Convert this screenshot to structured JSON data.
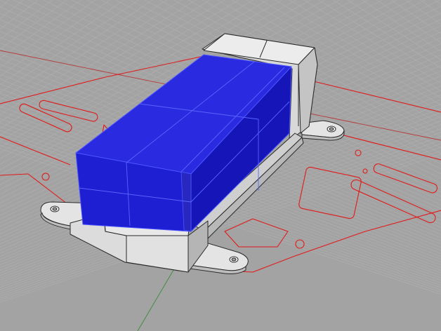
{
  "viewport": {
    "label": "",
    "projection": "perspective",
    "display_mode": "shaded",
    "grid": true
  },
  "colors": {
    "background": "#a3a3a3",
    "grid_line": "#b0b0b0",
    "grid_axis_x": "#b53a3a",
    "grid_axis_y": "#3a8a3a",
    "curve_outline": "#e01a1a",
    "battery_fill": "#1d1dcc",
    "battery_edge": "#5a64ff",
    "holder_face": "#e6e6e6",
    "holder_edge": "#2a2a2a"
  },
  "scene": {
    "objects": [
      {
        "name": "frame-plate-outline",
        "type": "curve"
      },
      {
        "name": "battery-holder",
        "type": "polysurface"
      },
      {
        "name": "battery-pack",
        "type": "polysurface",
        "selected": true
      },
      {
        "name": "mount-tab-left",
        "type": "polysurface"
      },
      {
        "name": "mount-tab-right",
        "type": "polysurface"
      },
      {
        "name": "mount-tab-top",
        "type": "polysurface"
      }
    ]
  }
}
